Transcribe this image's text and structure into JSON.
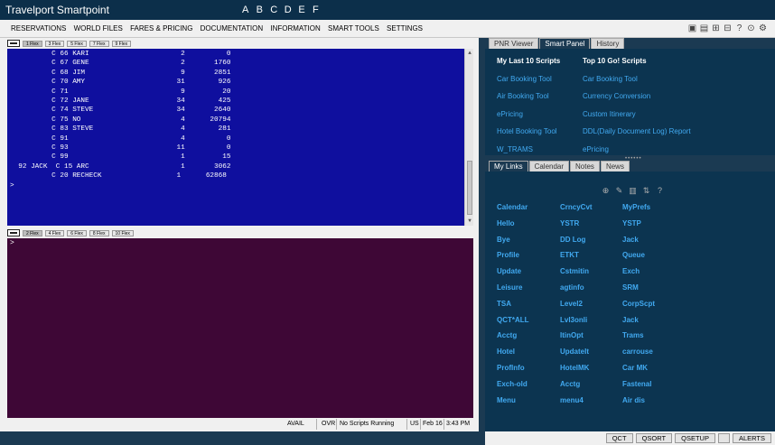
{
  "window": {
    "title": "Travelport Smartpoint",
    "letters": [
      "A",
      "B",
      "C",
      "D",
      "E",
      "F"
    ]
  },
  "menu": {
    "items": [
      "RESERVATIONS",
      "WORLD FILES",
      "FARES & PRICING",
      "DOCUMENTATION",
      "INFORMATION",
      "SMART TOOLS",
      "SETTINGS"
    ]
  },
  "toolbar_icons": [
    "cube-icon",
    "cubes-icon",
    "network-icon",
    "tree-icon",
    "help-icon",
    "lock-icon",
    "settings-icon"
  ],
  "terminal1": {
    "tabs": [
      "1 Flex",
      "3 Flex",
      "5 Flex",
      "7 Flex",
      "9 Flex"
    ],
    "lines": [
      "          C 66 KARI                      2          0",
      "          C 67 GENE                      2       1760",
      "          C 68 JIM                       9       2851",
      "          C 70 AMY                      31        926",
      "          C 71                           9         20",
      "          C 72 JANE                     34        425",
      "          C 74 STEVE                    34       2640",
      "          C 75 NO                        4      20794",
      "          C 83 STEVE                     4        281",
      "          C 91                           4          0",
      "          C 93                          11          0",
      "          C 99                           1         15",
      "  92 JACK  C 15 ARC                      1       3062",
      "          C 20 RECHECK                  1      62868",
      ">"
    ]
  },
  "terminal2": {
    "tabs": [
      "2 Flex",
      "4 Flex",
      "6 Flex",
      "8 Flex",
      "10 Flex"
    ],
    "prompt": ">"
  },
  "status": {
    "avail": "AVAIL",
    "ovr": "OVR",
    "scripts": "No Scripts Running",
    "locale": "US",
    "date": "Feb 16",
    "time": "3:43 PM"
  },
  "right_top": {
    "tabs": [
      "PNR Viewer",
      "Smart Panel",
      "History"
    ],
    "active": "Smart Panel",
    "col1_header": "My Last 10 Scripts",
    "col1_links": [
      "Car Booking Tool",
      "Air Booking Tool",
      "ePricing",
      "Hotel Booking Tool",
      "W_TRAMS"
    ],
    "col2_header": "Top 10 Go! Scripts",
    "col2_links": [
      "Car Booking Tool",
      "Currency Conversion",
      "Custom Itinerary",
      "DDL(Daily Document Log) Report",
      "ePricing"
    ]
  },
  "right_bottom": {
    "tabs": [
      "My Links",
      "Calendar",
      "Notes",
      "News"
    ],
    "active": "My Links",
    "links": [
      "Calendar",
      "CrncyCvt",
      "MyPrefs",
      "Hello",
      "YSTR",
      "YSTP",
      "Bye",
      "DD Log",
      "Jack",
      "Profile",
      "ETKT",
      "Queue",
      "Update",
      "Cstmitin",
      "Exch",
      "Leisure",
      "agtinfo",
      "SRM",
      "TSA",
      "Level2",
      "CorpScpt",
      "QCT*ALL",
      "Lvl3onli",
      "Jack",
      "Acctg",
      "ItinOpt",
      "Trams",
      "Hotel",
      "UpdateIt",
      "carrouse",
      "ProfInfo",
      "HotelMK",
      "Car MK",
      "Exch-old",
      "Acctg",
      "Fastenal",
      "Menu",
      "menu4",
      "Air dis"
    ]
  },
  "bottom_buttons": [
    "QCT",
    "QSORT",
    "QSETUP",
    "ALERTS"
  ]
}
